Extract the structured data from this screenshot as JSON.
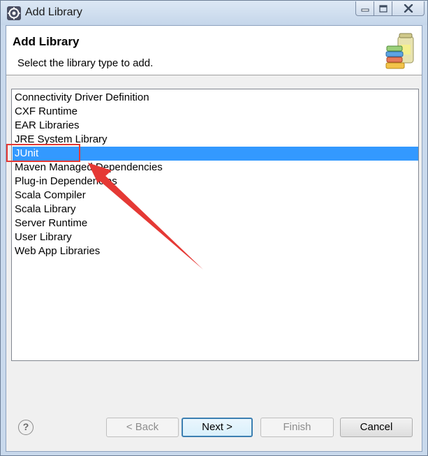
{
  "window": {
    "title": "Add Library"
  },
  "header": {
    "title": "Add Library",
    "description": "Select the library type to add."
  },
  "library_types": [
    {
      "label": "Connectivity Driver Definition",
      "selected": false
    },
    {
      "label": "CXF Runtime",
      "selected": false
    },
    {
      "label": "EAR Libraries",
      "selected": false
    },
    {
      "label": "JRE System Library",
      "selected": false
    },
    {
      "label": "JUnit",
      "selected": true
    },
    {
      "label": "Maven Managed Dependencies",
      "selected": false
    },
    {
      "label": "Plug-in Dependencies",
      "selected": false
    },
    {
      "label": "Scala Compiler",
      "selected": false
    },
    {
      "label": "Scala Library",
      "selected": false
    },
    {
      "label": "Server Runtime",
      "selected": false
    },
    {
      "label": "User Library",
      "selected": false
    },
    {
      "label": "Web App Libraries",
      "selected": false
    }
  ],
  "footer": {
    "help_label": "?",
    "back_label": "< Back",
    "next_label": "Next >",
    "finish_label": "Finish",
    "cancel_label": "Cancel"
  },
  "colors": {
    "selection": "#3399ff",
    "annotation": "#e53935"
  },
  "icons": {
    "app": "eclipse-icon",
    "header": "library-jars-icon",
    "help": "help-icon"
  }
}
